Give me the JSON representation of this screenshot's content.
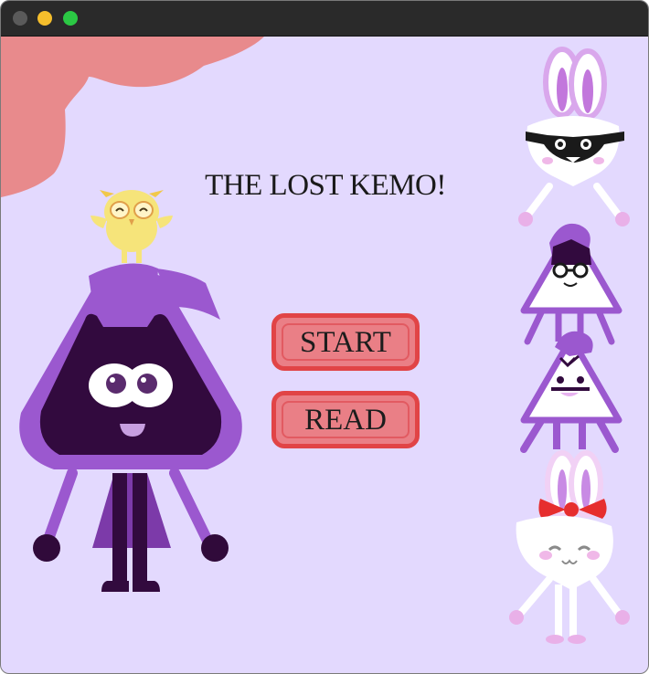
{
  "window": {
    "controls": [
      "close",
      "minimize",
      "maximize"
    ],
    "colors": {
      "titlebar": "#2a2a2a",
      "close": "#5a5a5a",
      "minimize": "#f5be2c",
      "maximize": "#2bc844"
    }
  },
  "game": {
    "title": "THE LOST KEMO!",
    "menu": {
      "start_label": "START",
      "read_label": "READ"
    },
    "colors": {
      "background": "#e3d9fe",
      "cloud": "#e88a8c",
      "button_fill": "#ea7f86",
      "button_border": "#e14446",
      "hero_purple": "#9b58cf",
      "hero_face": "#320a3e"
    },
    "characters": [
      {
        "name": "purple-hero",
        "icon": "purple-triangle-character"
      },
      {
        "name": "owl",
        "icon": "yellow-owl"
      },
      {
        "name": "bunny-with-glasses",
        "icon": "white-bunny-character"
      },
      {
        "name": "triangle-with-glasses",
        "icon": "white-triangle-character"
      },
      {
        "name": "triangle-sleepy",
        "icon": "white-triangle-character"
      },
      {
        "name": "bunny-with-bow",
        "icon": "white-bunny-character"
      }
    ]
  }
}
